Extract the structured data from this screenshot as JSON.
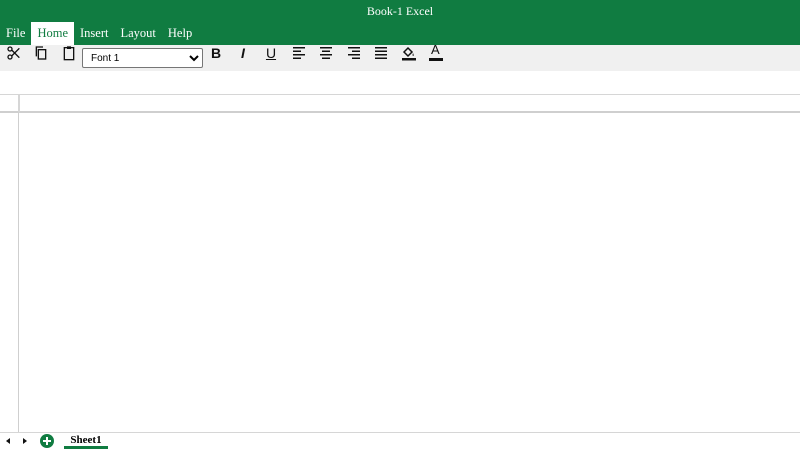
{
  "window": {
    "title": "Book-1 Excel"
  },
  "menu": {
    "items": [
      {
        "label": "File",
        "active": false
      },
      {
        "label": "Home",
        "active": true
      },
      {
        "label": "Insert",
        "active": false
      },
      {
        "label": "Layout",
        "active": false
      },
      {
        "label": "Help",
        "active": false
      }
    ]
  },
  "toolbar": {
    "icons": [
      "scissors-icon",
      "copy-icon",
      "paste-icon",
      "bold-icon",
      "italic-icon",
      "underline-icon",
      "align-left-icon",
      "align-center-icon",
      "align-right-icon",
      "align-justify-icon",
      "fill-color-icon",
      "font-color-icon"
    ],
    "bold_label": "B",
    "italic_label": "I",
    "underline_label": "U",
    "font_color_label": "A",
    "font_select": {
      "value": "Font 1",
      "options": [
        "Font 1"
      ]
    }
  },
  "sheets": {
    "tabs": [
      {
        "label": "Sheet1",
        "active": true
      }
    ]
  },
  "colors": {
    "accent": "#107c41",
    "toolbar_bg": "#f0f0f0",
    "grid_line": "#d6d6d6"
  }
}
